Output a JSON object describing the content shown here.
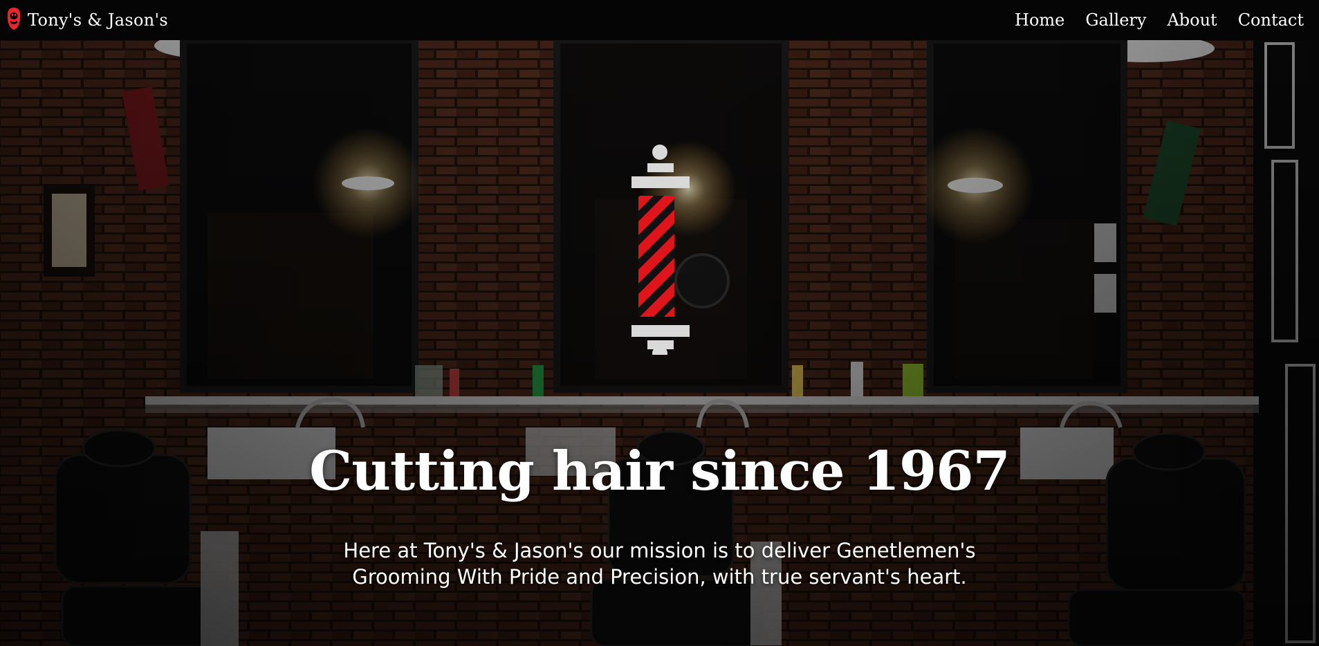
{
  "brand": {
    "name": "Tony's & Jason's",
    "icon": "bearded-man-icon",
    "accent_color": "#e8262b"
  },
  "nav": {
    "items": [
      {
        "label": "Home"
      },
      {
        "label": "Gallery"
      },
      {
        "label": "About"
      },
      {
        "label": "Contact"
      }
    ]
  },
  "hero": {
    "title": "Cutting hair since 1967",
    "subtitle_lines": [
      "Here at Tony's & Jason's our mission is to deliver Genetlemen's",
      "Grooming With Pride and Precision, with true servant's heart."
    ],
    "background": "barbershop-interior-photo",
    "pole_icon": "barber-pole-icon",
    "pole_colors": {
      "stripe_red": "#e0151b",
      "stripe_dark": "#111111",
      "caps": "#d9d9d9"
    }
  }
}
